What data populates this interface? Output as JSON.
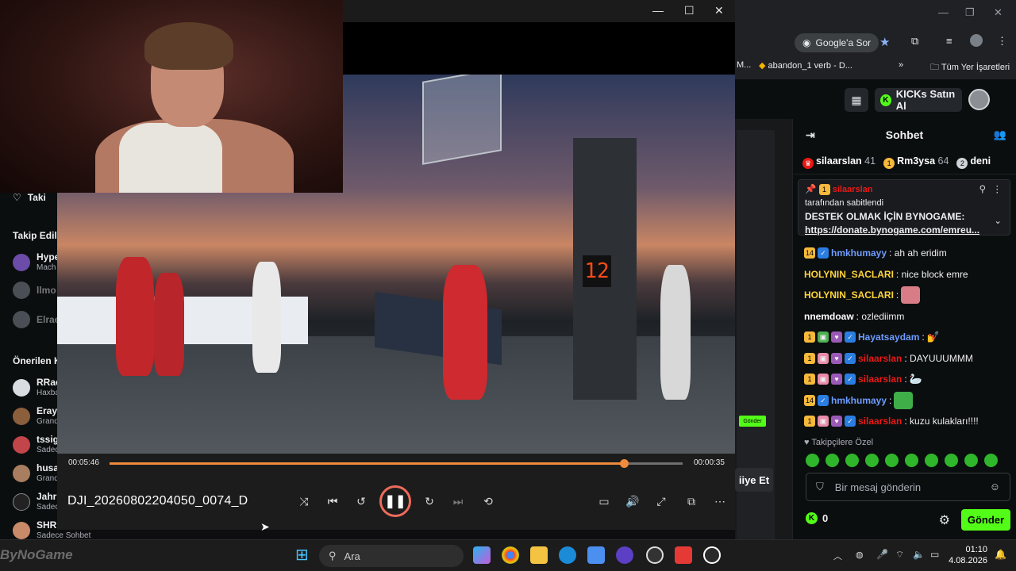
{
  "browser": {
    "google_pill": "Google'a Sor",
    "bookmarks": [
      "M...",
      "abandon_1 verb - D...",
      "»",
      "Tüm Yer İşaretleri"
    ]
  },
  "kick": {
    "buy_kicks": "KICKs Satın Al"
  },
  "chat": {
    "title": "Sohbet",
    "top_gifters": [
      {
        "name": "silaarslan",
        "count": "41"
      },
      {
        "name": "Rm3ysa",
        "count": "64"
      },
      {
        "name": "deni",
        "count": ""
      }
    ],
    "pinned": {
      "user": "silaarslan",
      "by": "tarafından sabitlendi",
      "text": "DESTEK OLMAK İÇİN BYNOGAME:",
      "link": "https://donate.bynogame.com/emreu..."
    },
    "messages": [
      {
        "user": "hmkhumayy",
        "text": ": ah ah eridim",
        "color": "#6e9cff"
      },
      {
        "user": "HOLYNIN_SACLARI",
        "text": ": nice block emre",
        "color": "#ffd43b"
      },
      {
        "user": "HOLYNIN_SACLARI",
        "text": ":",
        "color": "#ffd43b"
      },
      {
        "user": "nnemdoaw",
        "text": ": ozlediimm",
        "color": "#ffffff"
      },
      {
        "user": "Hayatsaydam",
        "text": ":",
        "color": "#6e9cff"
      },
      {
        "user": "silaarslan",
        "text": ": DAYUUUMMM",
        "color": "#e91916"
      },
      {
        "user": "silaarslan",
        "text": ":",
        "color": "#e91916"
      },
      {
        "user": "hmkhumayy",
        "text": ":",
        "color": "#6e9cff"
      },
      {
        "user": "silaarslan",
        "text": ": kuzu kulakları!!!!",
        "color": "#e91916"
      }
    ],
    "followers_only": "Takipçilere Özel",
    "placeholder": "Bir mesaj gönderin",
    "kicks_count": "0",
    "send": "Gönder"
  },
  "sidebar": {
    "following_partial": "Taki",
    "followed_heading": "Takip Edile",
    "suggested_heading": "Önerilen K",
    "items": [
      {
        "name": "Hype",
        "sub": "Mach"
      },
      {
        "name": "llmo",
        "sub": ""
      },
      {
        "name": "Elrae",
        "sub": ""
      },
      {
        "name": "RRae",
        "sub": "Haxba"
      },
      {
        "name": "Eray",
        "sub": "Grand"
      },
      {
        "name": "tssig",
        "sub": "Sadec"
      },
      {
        "name": "husa",
        "sub": "Grand"
      },
      {
        "name": "Jahr",
        "sub": "Sadec"
      },
      {
        "name": "SHRBR",
        "sub": "Sadece Sohbet"
      }
    ]
  },
  "player": {
    "elapsed": "00:05:46",
    "remaining": "00:00:35",
    "progress": 0.898,
    "filename": "DJI_20260802204050_0074_D",
    "shot_clock": "12"
  },
  "bg_strip": {
    "button": "Gönder",
    "partial": "iiye Et"
  },
  "taskbar": {
    "search": "Ara",
    "time": "01:10",
    "date": "4.08.2026"
  },
  "watermark": "ByNoGame"
}
